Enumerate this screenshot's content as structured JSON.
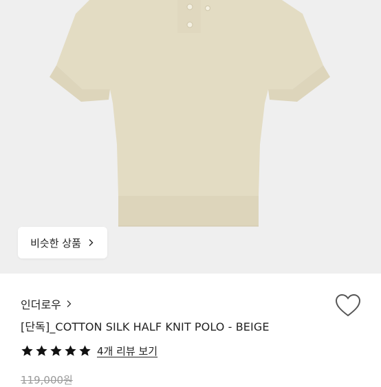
{
  "similar_button": {
    "label": "비슷한 상품",
    "icon": "chevron-right-icon"
  },
  "brand": {
    "name": "인더로우",
    "icon": "chevron-right-icon"
  },
  "product": {
    "title": "[단독]_COTTON SILK HALF KNIT POLO - BEIGE",
    "image_color": "#e3dcc3"
  },
  "rating": {
    "stars": 5,
    "review_link": "4개 리뷰 보기"
  },
  "price": {
    "original": "119,000원"
  },
  "wishlist": {
    "icon": "heart-outline-icon"
  }
}
